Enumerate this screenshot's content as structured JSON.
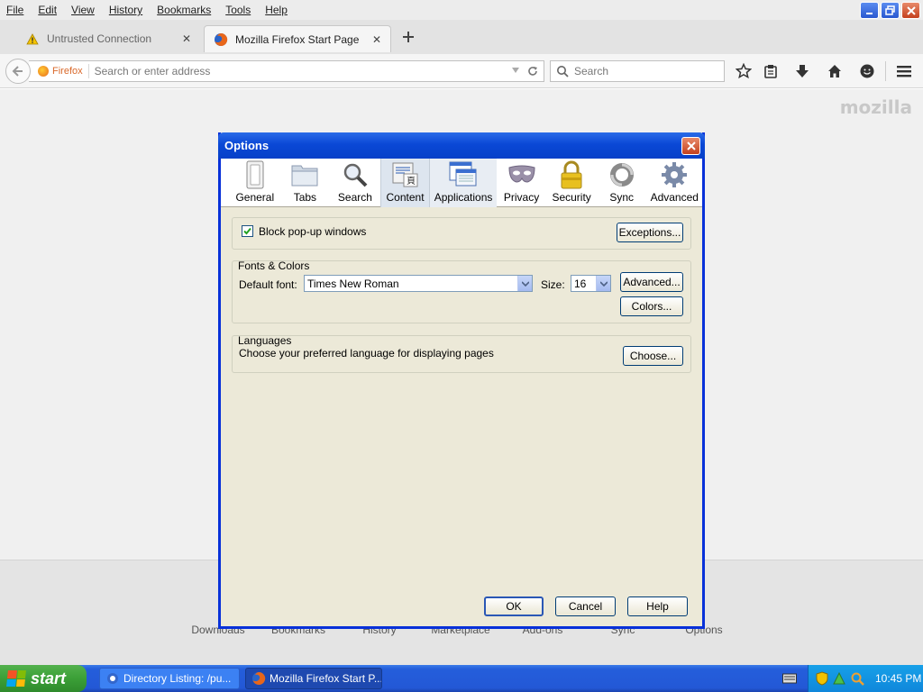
{
  "menubar": {
    "items": [
      "File",
      "Edit",
      "View",
      "History",
      "Bookmarks",
      "Tools",
      "Help"
    ]
  },
  "tabs": [
    {
      "label": "Untrusted Connection",
      "active": false,
      "icon": "warning-icon"
    },
    {
      "label": "Mozilla Firefox Start Page",
      "active": true,
      "icon": "firefox-icon"
    }
  ],
  "navbar": {
    "identity_label": "Firefox",
    "url_placeholder": "Search or enter address",
    "search_placeholder": "Search"
  },
  "page": {
    "logo_text": "mozilla",
    "launcher": [
      "Downloads",
      "Bookmarks",
      "History",
      "Marketplace",
      "Add-ons",
      "Sync",
      "Options"
    ]
  },
  "dialog": {
    "title": "Options",
    "panes": [
      {
        "label": "General",
        "icon": "switch-icon"
      },
      {
        "label": "Tabs",
        "icon": "folder-tabs-icon"
      },
      {
        "label": "Search",
        "icon": "magnifier-icon"
      },
      {
        "label": "Content",
        "icon": "content-page-icon",
        "selected": true
      },
      {
        "label": "Applications",
        "icon": "applications-window-icon",
        "hover": true
      },
      {
        "label": "Privacy",
        "icon": "mask-icon"
      },
      {
        "label": "Security",
        "icon": "padlock-icon"
      },
      {
        "label": "Sync",
        "icon": "sync-icon"
      },
      {
        "label": "Advanced",
        "icon": "gear-icon"
      }
    ],
    "popup": {
      "checkbox_label": "Block pop-up windows",
      "checked": true,
      "exceptions_button": "Exceptions..."
    },
    "fonts": {
      "caption": "Fonts & Colors",
      "default_font_label": "Default font:",
      "default_font_value": "Times New Roman",
      "size_label": "Size:",
      "size_value": "16",
      "advanced_button": "Advanced...",
      "colors_button": "Colors..."
    },
    "languages": {
      "caption": "Languages",
      "description": "Choose your preferred language for displaying pages",
      "choose_button": "Choose..."
    },
    "buttons": {
      "ok": "OK",
      "cancel": "Cancel",
      "help": "Help"
    }
  },
  "taskbar": {
    "start_label": "start",
    "items": [
      "Directory Listing: /pu...",
      "Mozilla Firefox Start P..."
    ],
    "clock": "10:45 PM"
  }
}
